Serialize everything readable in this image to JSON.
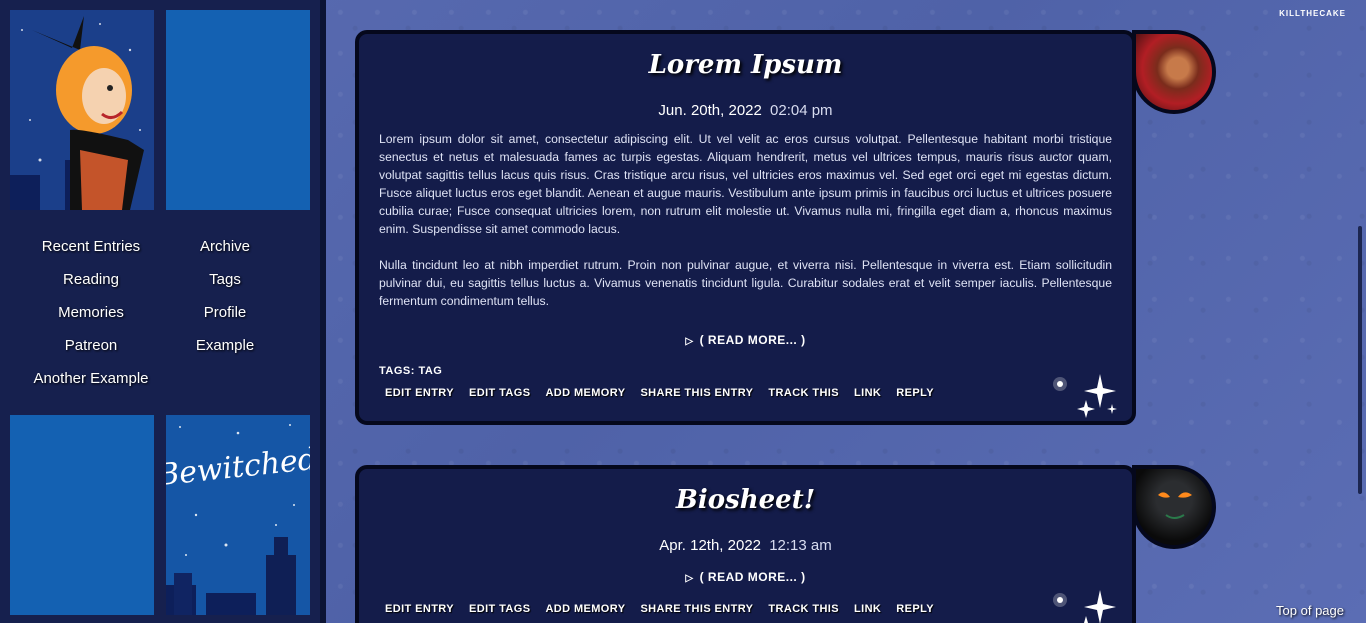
{
  "site": {
    "credit": "KILLTHECAKE",
    "top_link": "Top of page"
  },
  "sidebar": {
    "images": [
      {
        "name": "witch-illustration",
        "alt": ""
      },
      {
        "name": "blue-tile",
        "alt": ""
      },
      {
        "name": "blue-tile",
        "alt": ""
      },
      {
        "name": "bewitched-logo",
        "logo_text": "Bewitched"
      }
    ],
    "nav": [
      {
        "label": "Recent Entries"
      },
      {
        "label": "Archive"
      },
      {
        "label": "Reading"
      },
      {
        "label": "Tags"
      },
      {
        "label": "Memories"
      },
      {
        "label": "Profile"
      },
      {
        "label": "Patreon"
      },
      {
        "label": "Example"
      },
      {
        "label": "Another Example"
      }
    ]
  },
  "entries": [
    {
      "title": "Lorem Ipsum",
      "date": "Jun. 20th, 2022",
      "time": "02:04 pm",
      "body": [
        "Lorem ipsum dolor sit amet, consectetur adipiscing elit. Ut vel velit ac eros cursus volutpat. Pellentesque habitant morbi tristique senectus et netus et malesuada fames ac turpis egestas. Aliquam hendrerit, metus vel ultrices tempus, mauris risus auctor quam, volutpat sagittis tellus lacus quis risus. Cras tristique arcu risus, vel ultricies eros maximus vel. Sed eget orci eget mi egestas dictum. Fusce aliquet luctus eros eget blandit. Aenean et augue mauris. Vestibulum ante ipsum primis in faucibus orci luctus et ultrices posuere cubilia curae; Fusce consequat ultricies lorem, non rutrum elit molestie ut. Vivamus nulla mi, fringilla eget diam a, rhoncus maximus enim. Suspendisse sit amet commodo lacus.",
        "Nulla tincidunt leo at nibh imperdiet rutrum. Proin non pulvinar augue, et viverra nisi. Pellentesque in viverra est. Etiam sollicitudin pulvinar dui, eu sagittis tellus luctus a. Vivamus venenatis tincidunt ligula. Curabitur sodales erat et velit semper iaculis. Pellentesque fermentum condimentum tellus."
      ],
      "read_more": "( READ MORE... )",
      "tags_label": "TAGS:",
      "tags": "TAGS: TAG",
      "actions": [
        "EDIT ENTRY",
        "EDIT TAGS",
        "ADD MEMORY",
        "SHARE THIS ENTRY",
        "TRACK THIS",
        "LINK",
        "REPLY"
      ]
    },
    {
      "title": "Biosheet!",
      "date": "Apr. 12th, 2022",
      "time": "12:13 am",
      "read_more": "( READ MORE... )",
      "actions": [
        "EDIT ENTRY",
        "EDIT TAGS",
        "ADD MEMORY",
        "SHARE THIS ENTRY",
        "TRACK THIS",
        "LINK",
        "REPLY"
      ]
    }
  ]
}
